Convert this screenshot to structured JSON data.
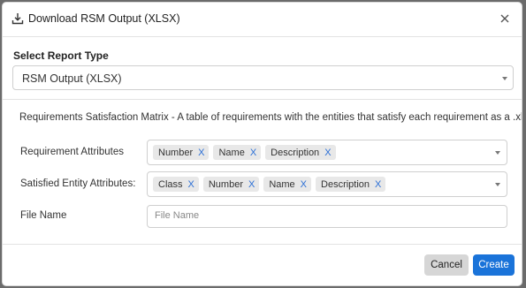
{
  "dialog": {
    "title": "Download RSM Output (XLSX)",
    "close_icon": "close-icon",
    "header_icon": "download-icon"
  },
  "report_type": {
    "label": "Select Report Type",
    "selected": "RSM Output (XLSX)"
  },
  "description": "Requirements Satisfaction Matrix - A table of requirements with the entities that satisfy each requirement as a .xlsx file.",
  "requirement_attributes": {
    "label": "Requirement Attributes",
    "tags": [
      "Number",
      "Name",
      "Description"
    ]
  },
  "satisfied_entity_attributes": {
    "label": "Satisfied Entity Attributes:",
    "tags": [
      "Class",
      "Number",
      "Name",
      "Description"
    ]
  },
  "file_name": {
    "label": "File Name",
    "value": "",
    "placeholder": "File Name"
  },
  "tag_remove_glyph": "X",
  "footer": {
    "cancel_label": "Cancel",
    "create_label": "Create"
  },
  "colors": {
    "primary": "#1a73d9",
    "tag_remove": "#2b6fd6",
    "cancel_bg": "#d6d6d6"
  }
}
